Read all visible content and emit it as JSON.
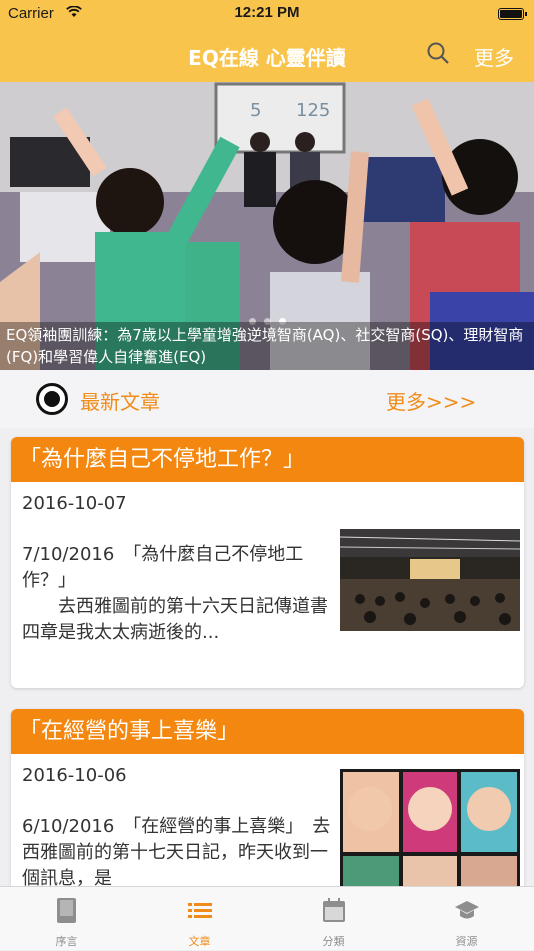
{
  "status_bar": {
    "carrier": "Carrier",
    "time": "12:21 PM"
  },
  "nav": {
    "title": "EQ在線 心靈伴讀",
    "more_label": "更多"
  },
  "banner": {
    "caption": "EQ領袖團訓練：為7歲以上學童增強逆境智商(AQ)、社交智商(SQ)、理財智商(FQ)和學習偉人自律奮進(EQ)",
    "whiteboard_numbers": [
      "5",
      "125"
    ]
  },
  "section": {
    "title": "最新文章",
    "more_label": "更多>>>"
  },
  "articles": [
    {
      "title": "「為什麼自己不停地工作？」",
      "date": "2016-10-07",
      "excerpt": "7/10/2016　「為什麼自己不停地工作？」\n　　去西雅圖前的第十六天日記傳道書四章是我太太病逝後的..."
    },
    {
      "title": "「在經營的事上喜樂」",
      "date": "2016-10-06",
      "excerpt": "6/10/2016　「在經營的事上喜樂」　去西雅圖前的第十七天日記，昨天收到一個訊息，是"
    }
  ],
  "tabs": [
    {
      "label": "序言",
      "icon": "book-icon"
    },
    {
      "label": "文章",
      "icon": "list-icon"
    },
    {
      "label": "分類",
      "icon": "calendar-icon"
    },
    {
      "label": "資源",
      "icon": "graduation-cap-icon"
    }
  ],
  "colors": {
    "header": "#f9c44c",
    "accent": "#f4870f",
    "text_accent": "#f08c1a"
  }
}
